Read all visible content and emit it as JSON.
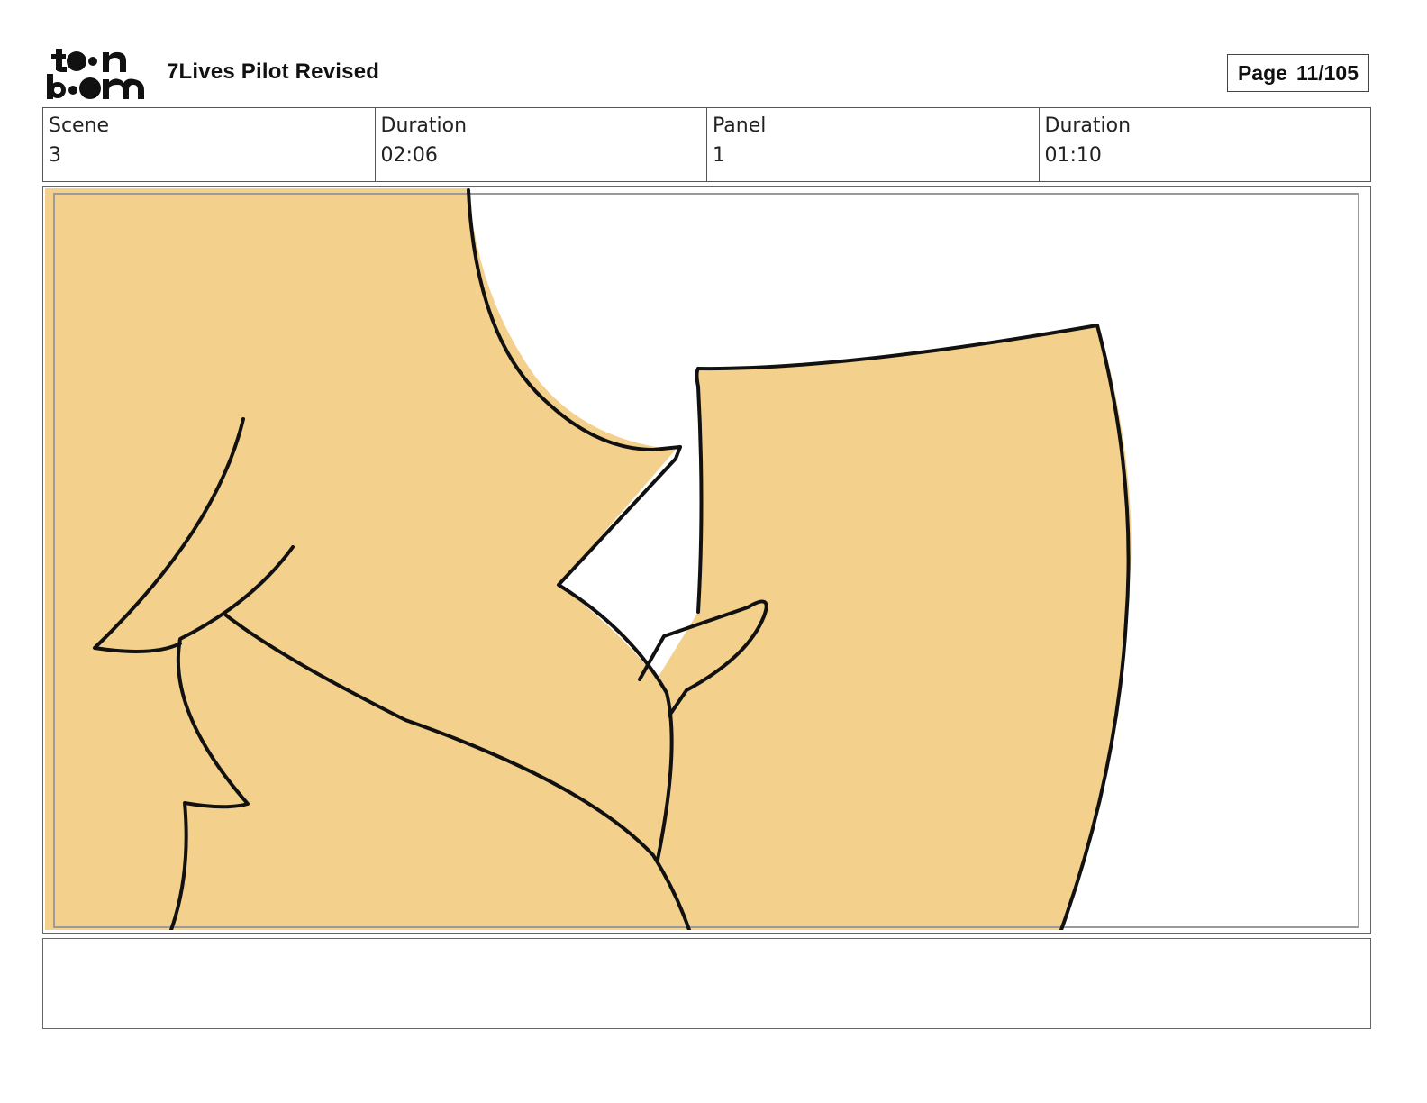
{
  "header": {
    "logo": {
      "icon": "toon-boom-logo",
      "line1": "toon",
      "line2": "boom"
    },
    "title": "7Lives Pilot Revised",
    "page": {
      "label": "Page",
      "value": "11/105"
    }
  },
  "info": [
    {
      "label": "Scene",
      "value": "3"
    },
    {
      "label": "Duration",
      "value": "02:06"
    },
    {
      "label": "Panel",
      "value": "1"
    },
    {
      "label": "Duration",
      "value": "01:10"
    }
  ],
  "panel": {
    "icon": "storyboard-drawing",
    "fill_color": "#f3d08b",
    "line_color": "#111111",
    "safe_frame_color": "#9a9a9a"
  },
  "notes": {
    "text": ""
  }
}
